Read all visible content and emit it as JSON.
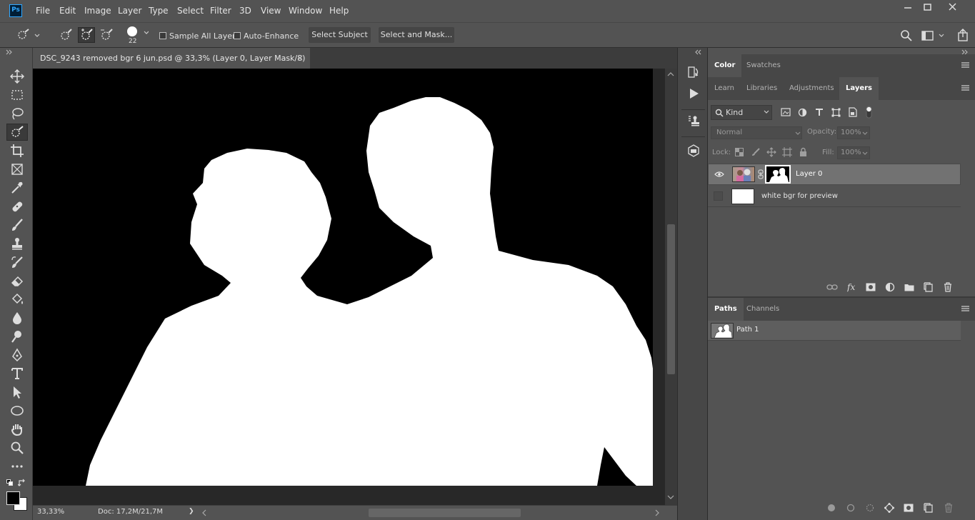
{
  "app": {
    "logo": "Ps"
  },
  "menu": [
    "File",
    "Edit",
    "Image",
    "Layer",
    "Type",
    "Select",
    "Filter",
    "3D",
    "View",
    "Window",
    "Help"
  ],
  "options": {
    "brush_size": "22",
    "sample_all_layers": "Sample All Layers",
    "auto_enhance": "Auto-Enhance",
    "select_subject": "Select Subject",
    "select_and_mask": "Select and Mask..."
  },
  "document": {
    "tab_title": "DSC_9243 removed bgr 6 jun.psd @ 33,3% (Layer 0, Layer Mask/8) *",
    "close_glyph": "×"
  },
  "status": {
    "zoom": "33,33%",
    "doc": "Doc: 17,2M/21,7M",
    "arrow": "❯"
  },
  "panels": {
    "top_tabs": [
      "Color",
      "Swatches"
    ],
    "layer_tabs": [
      "Learn",
      "Libraries",
      "Adjustments",
      "Layers"
    ],
    "filter_kind": "Kind",
    "blend_mode": "Normal",
    "opacity_label": "Opacity:",
    "opacity_value": "100%",
    "lock_label": "Lock:",
    "fill_label": "Fill:",
    "fill_value": "100%",
    "layers": [
      {
        "name": "Layer 0",
        "visible": true,
        "selected": true
      },
      {
        "name": "white bgr for preview",
        "visible": false,
        "selected": false
      }
    ],
    "paths_tabs": [
      "Paths",
      "Channels"
    ],
    "paths": [
      {
        "name": "Path 1"
      }
    ]
  },
  "colors": {
    "accent": "#31a8ff",
    "ui_bg": "#535353",
    "panel_dark": "#474747",
    "canvas_bg": "#282828"
  }
}
